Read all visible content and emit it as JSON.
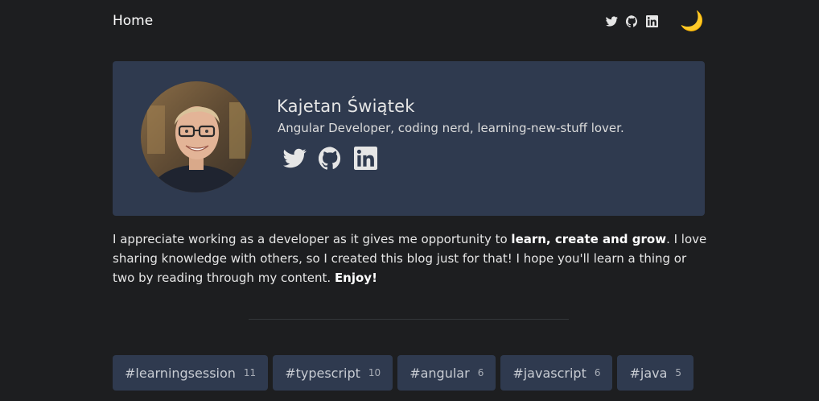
{
  "header": {
    "home_label": "Home",
    "social_icons": [
      "twitter-icon",
      "github-icon",
      "linkedin-icon"
    ],
    "theme_toggle_icon": "moon-icon",
    "theme_toggle_glyph": "🌙"
  },
  "profile": {
    "name": "Kajetan Świątek",
    "bio": "Angular Developer, coding nerd, learning-new-stuff lover.",
    "social_icons": [
      "twitter-icon",
      "github-icon",
      "linkedin-icon"
    ]
  },
  "about": {
    "part1": "I appreciate working as a developer as it gives me opportunity to ",
    "bold1": "learn, create and grow",
    "part2": ". I love sharing knowledge with others, so I created this blog just for that! I hope you'll learn a thing or two by reading through my content. ",
    "bold2": "Enjoy!"
  },
  "tags": [
    {
      "label": "#learningsession",
      "count": "11"
    },
    {
      "label": "#typescript",
      "count": "10"
    },
    {
      "label": "#angular",
      "count": "6"
    },
    {
      "label": "#javascript",
      "count": "6"
    },
    {
      "label": "#java",
      "count": "5"
    }
  ],
  "colors": {
    "background": "#1d1e20",
    "card": "#2f3a4f",
    "text": "#e6e6e6",
    "accent_moon": "#f7c948"
  }
}
